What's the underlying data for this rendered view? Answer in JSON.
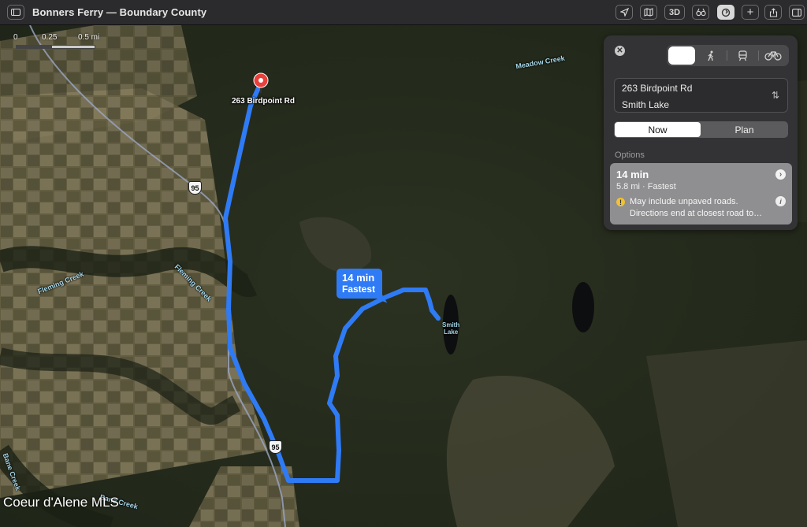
{
  "window": {
    "title": "Bonners Ferry — Boundary County"
  },
  "toolbar": {
    "buttons": [
      {
        "name": "location",
        "icon": "location-arrow-icon",
        "glyph": "➤"
      },
      {
        "name": "map-mode",
        "icon": "map-icon",
        "glyph": "▥"
      },
      {
        "name": "3d",
        "label": "3D"
      },
      {
        "name": "look-around",
        "icon": "binoculars-icon",
        "glyph": "⊚"
      },
      {
        "name": "directions",
        "icon": "directions-icon",
        "glyph": "↻",
        "active": true
      },
      {
        "name": "add",
        "icon": "plus-icon",
        "glyph": "+"
      },
      {
        "name": "share",
        "icon": "share-icon",
        "glyph": "⇪"
      },
      {
        "name": "sidebar-right",
        "icon": "sidebar-right-icon",
        "glyph": "▯"
      }
    ]
  },
  "map": {
    "scale": {
      "labels": [
        "0",
        "0.25",
        "0.5 mi"
      ]
    },
    "pin_label": "263 Birdpoint Rd",
    "route_callout": {
      "time": "14 min",
      "label": "Fastest"
    },
    "labels": {
      "meadow_creek": "Meadow Creek",
      "fleming_creek_1": "Fleming Creek",
      "fleming_creek_2": "Fleming Creek",
      "bane_creek_1": "Bane Creek",
      "bane_creek_2": "Bane Creek",
      "smith_lake": "Smith\nLake"
    },
    "highway_shield": "95",
    "watermark": "Coeur d'Alene MLS",
    "colors": {
      "route": "#2f7bf6",
      "pin": "#e8413c"
    }
  },
  "directions": {
    "from": "263 Birdpoint Rd",
    "to": "Smith Lake",
    "timing": {
      "now": "Now",
      "plan": "Plan",
      "selected": "Now"
    },
    "transport_modes": [
      {
        "name": "drive",
        "icon": "car-icon",
        "selected": true
      },
      {
        "name": "walk",
        "icon": "walking-icon",
        "glyph": "🚶"
      },
      {
        "name": "transit",
        "icon": "train-icon",
        "glyph": "🚆"
      },
      {
        "name": "cycle",
        "icon": "bicycle-icon",
        "glyph": "🚲"
      }
    ],
    "options_heading": "Options",
    "options": [
      {
        "time": "14 min",
        "summary": "5.8 mi · Fastest",
        "warning_line1": "May include unpaved roads.",
        "warning_line2": "Directions end at closest road to…"
      }
    ]
  }
}
